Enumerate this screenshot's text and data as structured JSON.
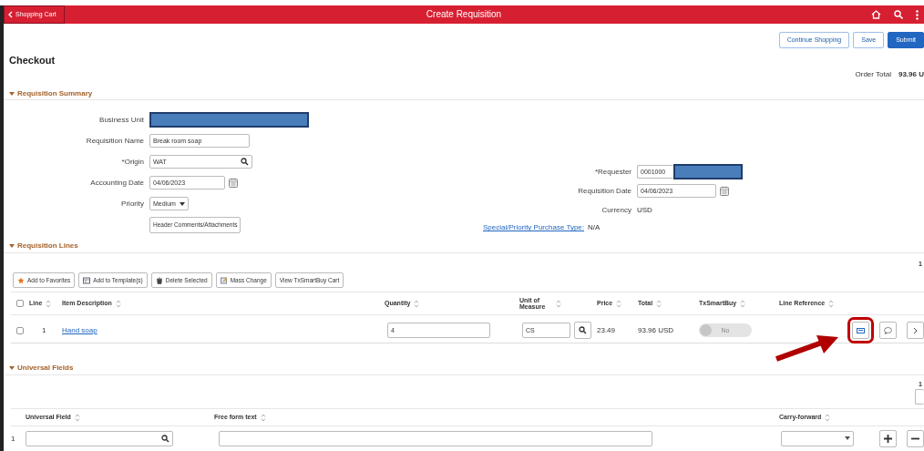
{
  "header": {
    "back": "Shopping Cart",
    "title": "Create Requisition"
  },
  "actions": [
    {
      "label": "Continue Shopping",
      "kind": "outline"
    },
    {
      "label": "Save",
      "kind": "outline"
    },
    {
      "label": "Submit",
      "kind": "primary"
    }
  ],
  "page_title": "Checkout",
  "order_total": {
    "label": "Order Total",
    "value": "93.96 U"
  },
  "summary": {
    "title": "Requisition Summary",
    "expanded": true,
    "left_fields": [
      {
        "label": "Business Unit",
        "kind": "redacted"
      },
      {
        "label": "Requisition Name",
        "kind": "text",
        "value": "Break room soap"
      },
      {
        "label": "*Origin",
        "kind": "lookup",
        "value": "WAT"
      },
      {
        "label": "Accounting Date",
        "kind": "date",
        "value": "04/06/2023"
      },
      {
        "label": "Priority",
        "kind": "select",
        "value": "Medium"
      },
      {
        "kind": "button",
        "value": "Header Comments/Attachments"
      }
    ],
    "right_fields": [
      {
        "label": "*Requester",
        "kind": "redacted",
        "value": "0001000"
      },
      {
        "label": "Requisition Date",
        "kind": "date",
        "value": "04/06/2023"
      },
      {
        "label": "Currency",
        "kind": "static",
        "value": "USD"
      }
    ],
    "special": {
      "label": "Special/Priority Purchase Type:",
      "value": "N/A"
    }
  },
  "lines": {
    "title": "Requisition Lines",
    "expanded": true,
    "count": "1",
    "toolbar": [
      {
        "label": "Add to Favorites",
        "kind": "star"
      },
      {
        "label": "Add to Template(s)",
        "kind": "template"
      },
      {
        "label": "Delete Selected",
        "kind": "trash"
      },
      {
        "label": "Mass Change",
        "kind": "edit"
      },
      {
        "label": "View TxSmartBuy Cart",
        "kind": "plain"
      }
    ],
    "select_all_checked": false,
    "columns": [
      "Line",
      "Item Description",
      "Quantity",
      "Unit of Measure",
      "Price",
      "Total",
      "TxSmartBuy",
      "Line Reference"
    ],
    "rows": [
      {
        "checked": false,
        "line": "1",
        "item": "Hand soap",
        "quantity": "4",
        "uom": "CS",
        "price": "23.49",
        "total": "93.96 USD",
        "smartbuy": {
          "on": false,
          "label": "No"
        },
        "details_highlighted": true,
        "details_pointed": true
      }
    ]
  },
  "universal": {
    "title": "Universal Fields",
    "expanded": true,
    "count": "1",
    "columns": [
      "Universal Field",
      "Free form text",
      "Carry-forward"
    ],
    "rows": [
      {
        "num": "1"
      }
    ]
  }
}
